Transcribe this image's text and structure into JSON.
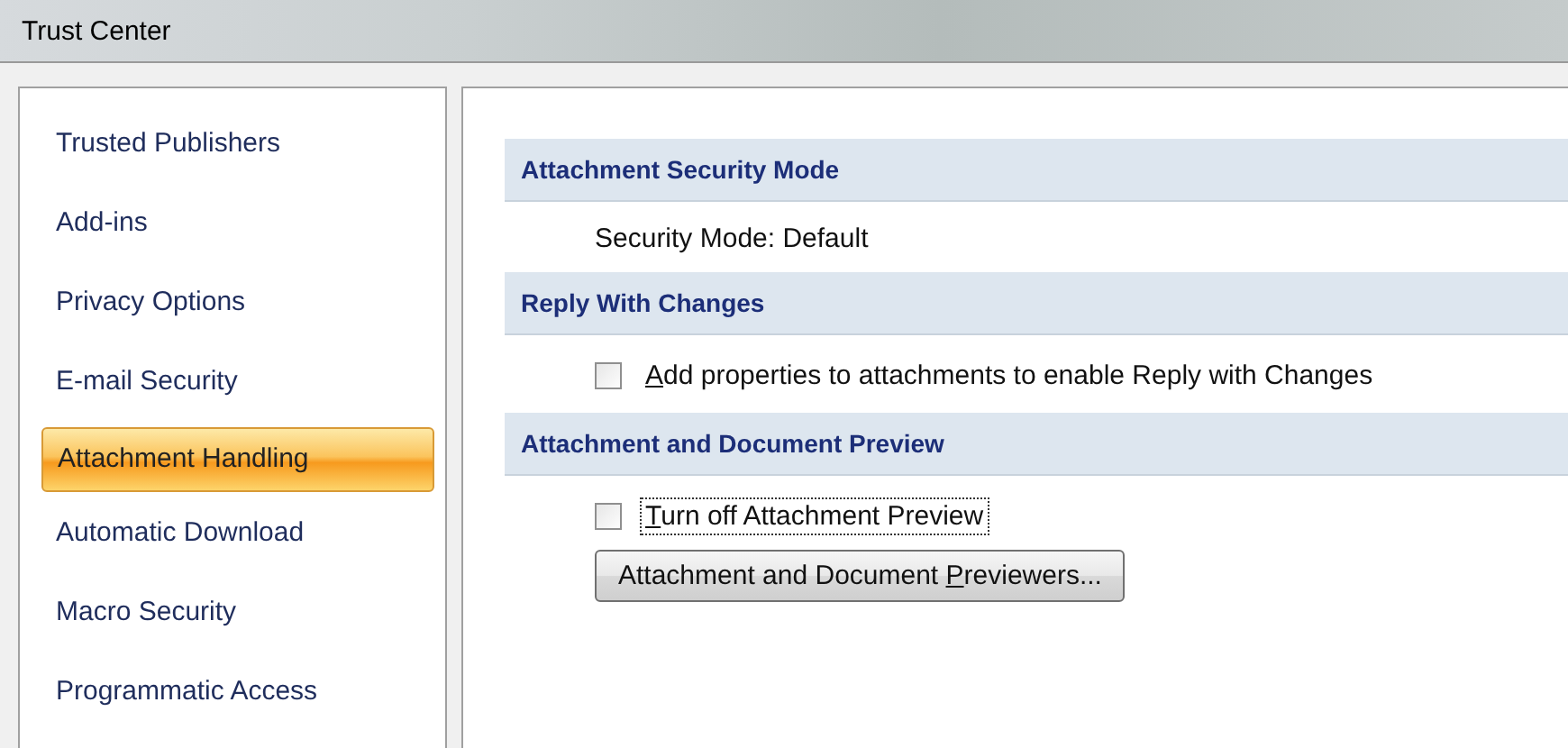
{
  "window": {
    "title": "Trust Center"
  },
  "sidebar": {
    "items": [
      {
        "label": "Trusted Publishers",
        "selected": false
      },
      {
        "label": "Add-ins",
        "selected": false
      },
      {
        "label": "Privacy Options",
        "selected": false
      },
      {
        "label": "E-mail Security",
        "selected": false
      },
      {
        "label": "Attachment Handling",
        "selected": true
      },
      {
        "label": "Automatic Download",
        "selected": false
      },
      {
        "label": "Macro Security",
        "selected": false
      },
      {
        "label": "Programmatic Access",
        "selected": false
      }
    ]
  },
  "sections": [
    {
      "title": "Attachment Security Mode",
      "items": [
        {
          "kind": "text",
          "text": "Security Mode: Default"
        }
      ]
    },
    {
      "title": "Reply With Changes",
      "items": [
        {
          "kind": "checkbox",
          "access_key": "A",
          "label_rest": "dd properties to attachments to enable Reply with Changes",
          "checked": false,
          "focused": false
        }
      ]
    },
    {
      "title": "Attachment and Document Preview",
      "items": [
        {
          "kind": "checkbox",
          "access_key": "T",
          "label_rest": "urn off Attachment Preview",
          "checked": false,
          "focused": true
        },
        {
          "kind": "button",
          "label_before": "Attachment and Document ",
          "access_key": "P",
          "label_rest": "reviewers..."
        }
      ]
    }
  ]
}
